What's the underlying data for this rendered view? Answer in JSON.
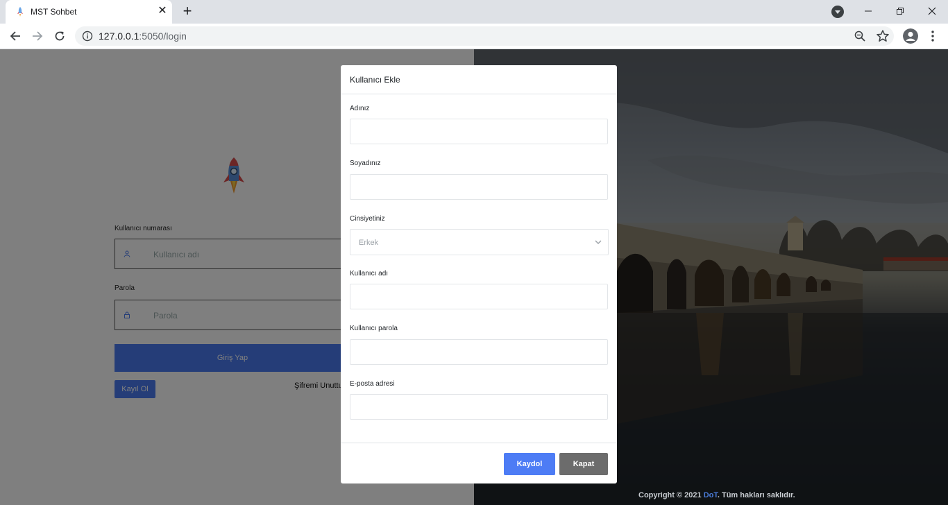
{
  "browser": {
    "tab_title": "MST Sohbet",
    "url_host": "127.0.0.1",
    "url_path": ":5050/login"
  },
  "login": {
    "username_label": "Kullanıcı numarası",
    "username_placeholder": "Kullanıcı adı",
    "password_label": "Parola",
    "password_placeholder": "Parola",
    "login_button": "Giriş Yap",
    "register_button": "Kayıl Ol",
    "forgot_link": "Şifremi Unuttu"
  },
  "footer": {
    "copyright_prefix": "Copyright © 2021 ",
    "brand": "DoT",
    "copyright_suffix": ". Tüm hakları saklıdır."
  },
  "modal": {
    "title": "Kullanıcı Ekle",
    "first_name_label": "Adınız",
    "last_name_label": "Soyadınız",
    "gender_label": "Cinsiyetiniz",
    "gender_value": "Erkek",
    "username_label": "Kullanıcı adı",
    "password_label": "Kullanıcı parola",
    "email_label": "E-posta adresi",
    "save_button": "Kaydol",
    "close_button": "Kapat"
  },
  "colors": {
    "primary": "#4d7cf5",
    "secondary": "#6c6c6c",
    "brand_link": "#4a7bd8"
  }
}
